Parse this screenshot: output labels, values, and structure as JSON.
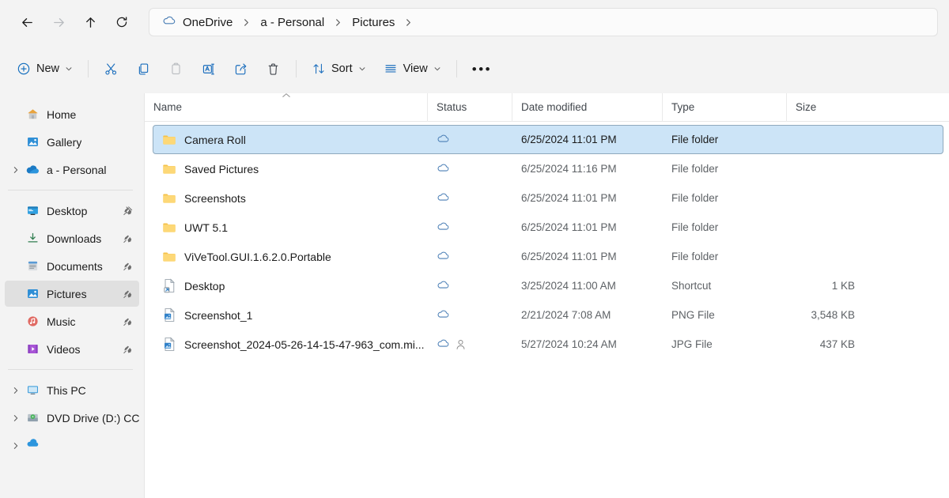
{
  "nav": {
    "back": "Back",
    "forward": "Forward",
    "up": "Up",
    "refresh": "Refresh"
  },
  "breadcrumb": {
    "items": [
      {
        "label": "OneDrive",
        "icon": "onedrive-cloud-icon"
      },
      {
        "label": "a - Personal",
        "icon": ""
      },
      {
        "label": "Pictures",
        "icon": ""
      }
    ]
  },
  "toolbar": {
    "new_label": "New",
    "cut_label": "Cut",
    "copy_label": "Copy",
    "paste_label": "Paste",
    "rename_label": "Rename",
    "share_label": "Share",
    "delete_label": "Delete",
    "sort_label": "Sort",
    "view_label": "View",
    "more_label": "See more"
  },
  "sidebar": {
    "groups": [
      {
        "items": [
          {
            "label": "Home",
            "icon": "home-icon",
            "expander": false,
            "pinned": false,
            "selected": false
          },
          {
            "label": "Gallery",
            "icon": "gallery-icon",
            "expander": false,
            "pinned": false,
            "selected": false
          },
          {
            "label": "a - Personal",
            "icon": "onedrive-icon",
            "expander": true,
            "pinned": false,
            "selected": false
          }
        ]
      },
      {
        "items": [
          {
            "label": "Desktop",
            "icon": "desktop-icon",
            "expander": false,
            "pinned": true,
            "selected": false
          },
          {
            "label": "Downloads",
            "icon": "downloads-icon",
            "expander": false,
            "pinned": true,
            "selected": false
          },
          {
            "label": "Documents",
            "icon": "documents-icon",
            "expander": false,
            "pinned": true,
            "selected": false
          },
          {
            "label": "Pictures",
            "icon": "pictures-icon",
            "expander": false,
            "pinned": true,
            "selected": true
          },
          {
            "label": "Music",
            "icon": "music-icon",
            "expander": false,
            "pinned": true,
            "selected": false
          },
          {
            "label": "Videos",
            "icon": "videos-icon",
            "expander": false,
            "pinned": true,
            "selected": false
          }
        ]
      },
      {
        "items": [
          {
            "label": "This PC",
            "icon": "thispc-icon",
            "expander": true,
            "pinned": false,
            "selected": false
          },
          {
            "label": "DVD Drive (D:) CCC",
            "icon": "dvd-drive-icon",
            "expander": true,
            "pinned": false,
            "selected": false
          }
        ]
      }
    ]
  },
  "columns": {
    "name": "Name",
    "status": "Status",
    "date_modified": "Date modified",
    "type": "Type",
    "size": "Size",
    "sorted_by": "Name",
    "sort_direction": "ascending"
  },
  "files": [
    {
      "name": "Camera Roll",
      "icon": "folder-icon",
      "status": "cloud-icon",
      "shared": false,
      "date": "6/25/2024 11:01 PM",
      "type": "File folder",
      "size": "",
      "selected": true
    },
    {
      "name": "Saved Pictures",
      "icon": "folder-icon",
      "status": "cloud-icon",
      "shared": false,
      "date": "6/25/2024 11:16 PM",
      "type": "File folder",
      "size": "",
      "selected": false
    },
    {
      "name": "Screenshots",
      "icon": "folder-icon",
      "status": "cloud-icon",
      "shared": false,
      "date": "6/25/2024 11:01 PM",
      "type": "File folder",
      "size": "",
      "selected": false
    },
    {
      "name": "UWT 5.1",
      "icon": "folder-icon",
      "status": "cloud-icon",
      "shared": false,
      "date": "6/25/2024 11:01 PM",
      "type": "File folder",
      "size": "",
      "selected": false
    },
    {
      "name": "ViVeTool.GUI.1.6.2.0.Portable",
      "icon": "folder-icon",
      "status": "cloud-icon",
      "shared": false,
      "date": "6/25/2024 11:01 PM",
      "type": "File folder",
      "size": "",
      "selected": false
    },
    {
      "name": "Desktop",
      "icon": "shortcut-icon",
      "status": "cloud-icon",
      "shared": false,
      "date": "3/25/2024 11:00 AM",
      "type": "Shortcut",
      "size": "1 KB",
      "selected": false
    },
    {
      "name": "Screenshot_1",
      "icon": "image-file-icon",
      "status": "cloud-icon",
      "shared": false,
      "date": "2/21/2024 7:08 AM",
      "type": "PNG File",
      "size": "3,548 KB",
      "selected": false
    },
    {
      "name": "Screenshot_2024-05-26-14-15-47-963_com.mi...",
      "icon": "image-file-icon",
      "status": "cloud-icon",
      "shared": true,
      "date": "5/27/2024 10:24 AM",
      "type": "JPG File",
      "size": "437 KB",
      "selected": false
    }
  ],
  "colors": {
    "selection": "#cce4f7",
    "selection_border": "#8fa9bd",
    "sidebar_selection": "#e0e0e0",
    "chrome": "#f3f3f3",
    "content": "#ffffff",
    "folder": "#ffd16a",
    "cloud": "#4a7eb5",
    "accent": "#0f6cbd"
  }
}
